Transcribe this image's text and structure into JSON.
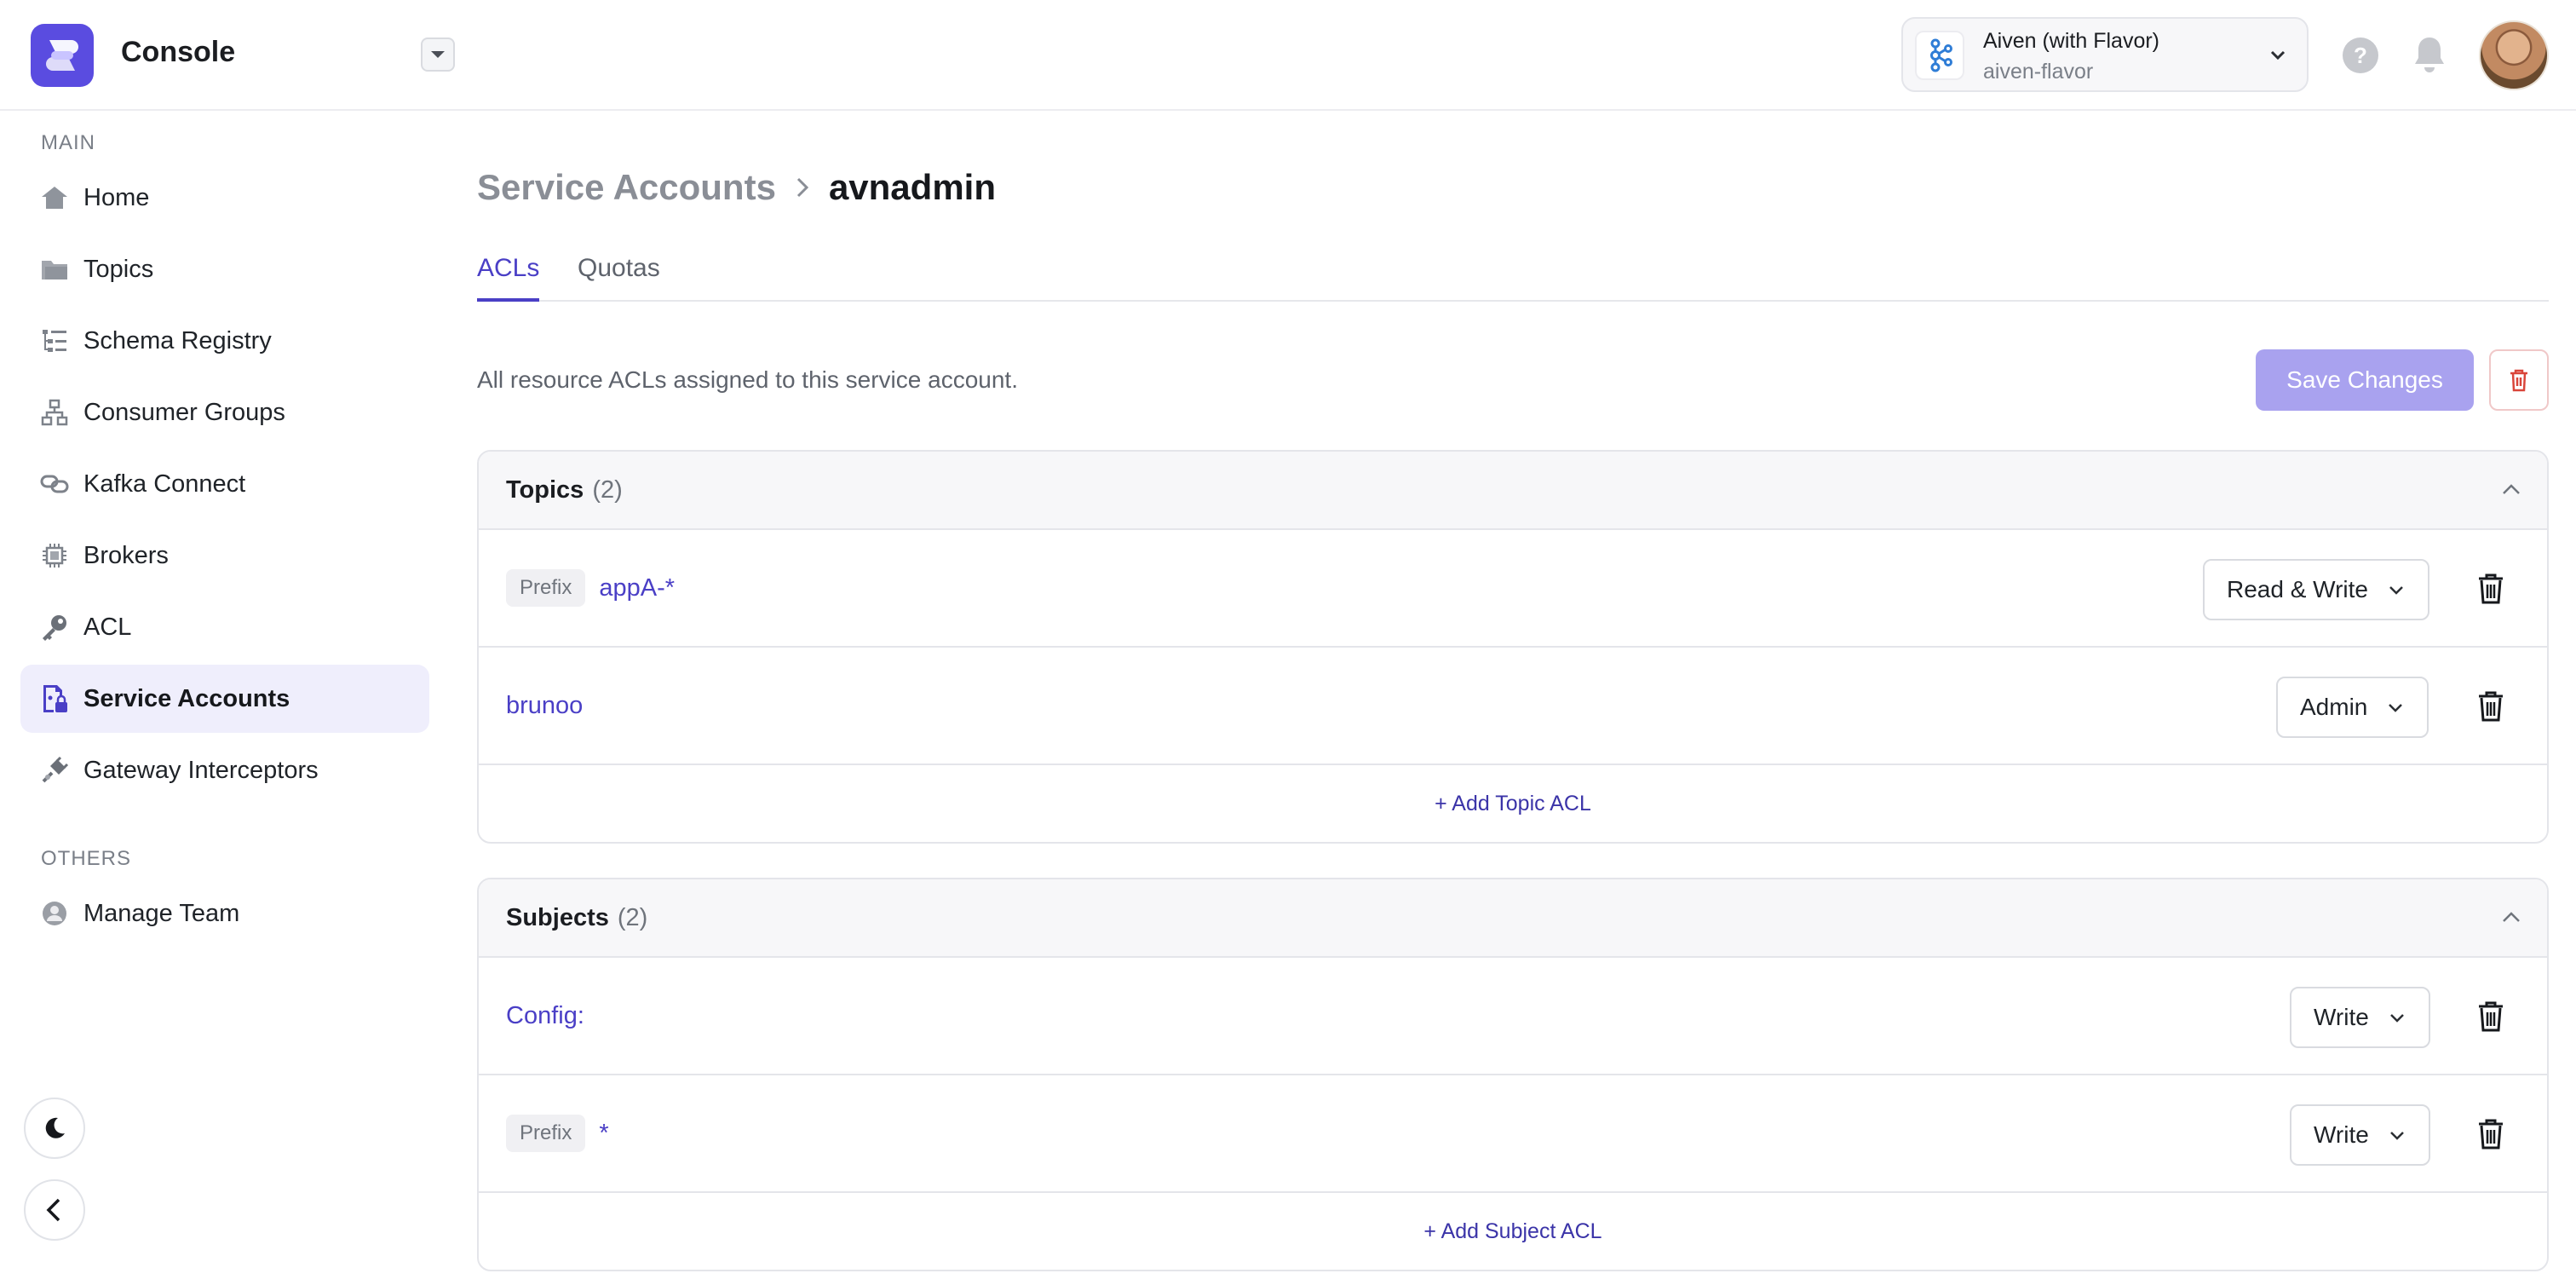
{
  "header": {
    "app_title": "Console",
    "org": {
      "name": "Aiven (with Flavor)",
      "slug": "aiven-flavor"
    },
    "help_label": "?"
  },
  "sidebar": {
    "main_label": "MAIN",
    "others_label": "OTHERS",
    "items": [
      {
        "label": "Home",
        "icon": "home-icon"
      },
      {
        "label": "Topics",
        "icon": "folder-icon"
      },
      {
        "label": "Schema Registry",
        "icon": "list-tree-icon"
      },
      {
        "label": "Consumer Groups",
        "icon": "hierarchy-icon"
      },
      {
        "label": "Kafka Connect",
        "icon": "link-icon"
      },
      {
        "label": "Brokers",
        "icon": "chip-icon"
      },
      {
        "label": "ACL",
        "icon": "key-icon"
      },
      {
        "label": "Service Accounts",
        "icon": "user-lock-icon",
        "active": true
      },
      {
        "label": "Gateway Interceptors",
        "icon": "plug-icon"
      }
    ],
    "others": [
      {
        "label": "Manage Team",
        "icon": "user-circle-icon"
      }
    ]
  },
  "main": {
    "breadcrumb": {
      "parent": "Service Accounts",
      "current": "avnadmin"
    },
    "tabs": [
      {
        "label": "ACLs",
        "active": true
      },
      {
        "label": "Quotas",
        "active": false
      }
    ],
    "subtitle": "All resource ACLs assigned to this service account.",
    "save_label": "Save Changes",
    "topics": {
      "title": "Topics",
      "count": "(2)",
      "rows": [
        {
          "tag": "Prefix",
          "name": "appA-*",
          "permission": "Read & Write"
        },
        {
          "tag": "",
          "name": "brunoo",
          "permission": "Admin"
        }
      ],
      "add_label": "+ Add Topic ACL"
    },
    "subjects": {
      "title": "Subjects",
      "count": "(2)",
      "rows": [
        {
          "tag": "",
          "name": "Config:",
          "permission": "Write"
        },
        {
          "tag": "Prefix",
          "name": "*",
          "permission": "Write"
        }
      ],
      "add_label": "+ Add Subject ACL"
    }
  },
  "colors": {
    "accent": "#5a4ce0",
    "link": "#4a3fc6",
    "save_button": "#a9a2ef",
    "danger": "#d9453a"
  }
}
